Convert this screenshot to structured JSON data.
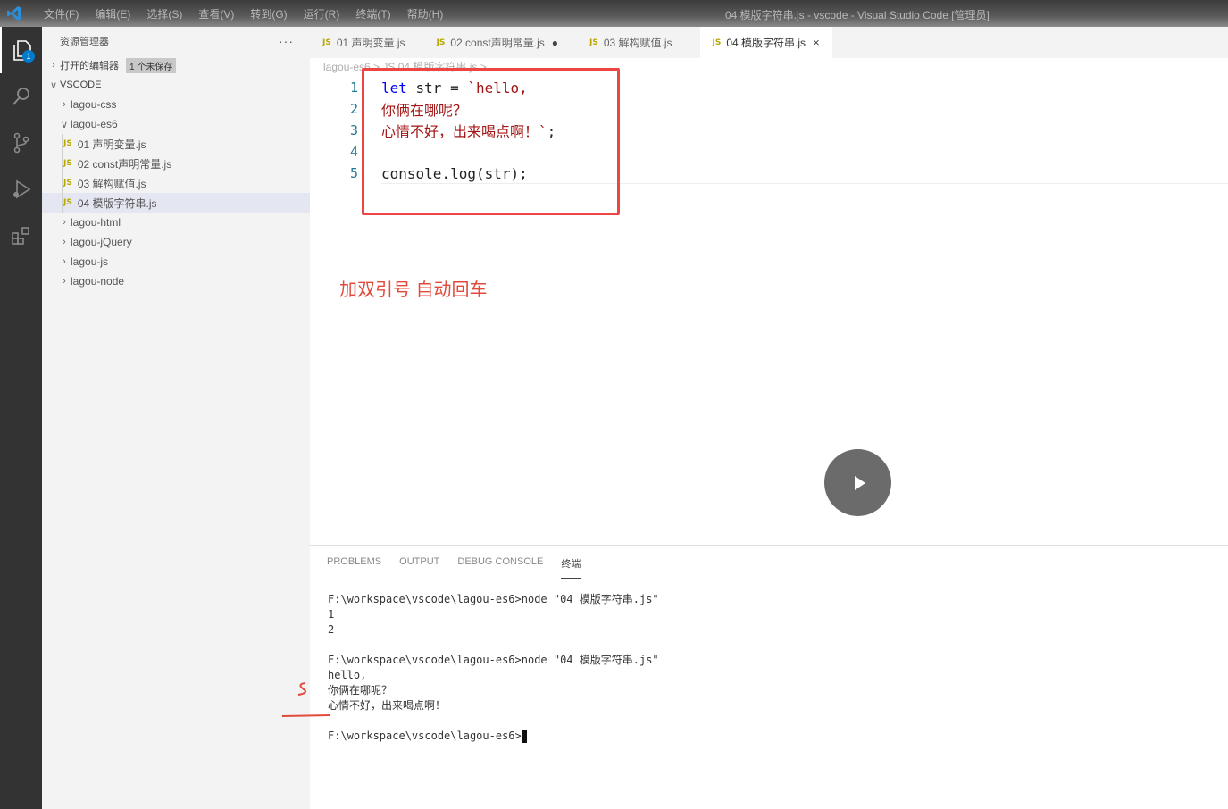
{
  "titlebar": {
    "menu": [
      "文件(F)",
      "编辑(E)",
      "选择(S)",
      "查看(V)",
      "转到(G)",
      "运行(R)",
      "终端(T)",
      "帮助(H)"
    ],
    "window_title": "04 模版字符串.js - vscode - Visual Studio Code [管理员]"
  },
  "activity": {
    "items": [
      "explorer-icon",
      "search-icon",
      "source-control-icon",
      "run-debug-icon",
      "extensions-icon"
    ],
    "explorer_badge": "1"
  },
  "sidebar": {
    "title": "资源管理器",
    "more": "···",
    "open_editors": {
      "label": "打开的编辑器",
      "tag": "1 个未保存"
    },
    "root": "VSCODE",
    "folders": {
      "lagou_css": "lagou-css",
      "lagou_es6": "lagou-es6",
      "lagou_html": "lagou-html",
      "lagou_jquery": "lagou-jQuery",
      "lagou_js": "lagou-js",
      "lagou_node": "lagou-node"
    },
    "files": [
      "01 声明变量.js",
      "02 const声明常量.js",
      "03 解构赋值.js",
      "04 模版字符串.js"
    ]
  },
  "tabs": [
    {
      "label": "01 声明变量.js"
    },
    {
      "label": "02 const声明常量.js",
      "dirty": "●"
    },
    {
      "label": "03 解构赋值.js"
    },
    {
      "label": "04 模版字符串.js",
      "close": "×"
    }
  ],
  "breadcrumb": "lagou-es6 > JS 04 模版字符串.js > ...",
  "editor": {
    "line_numbers": [
      "1",
      "2",
      "3",
      "4",
      "5"
    ],
    "line1_kw": "let",
    "line1_plain": " str = ",
    "line1_str": "`hello,",
    "line2_str": "你俩在哪呢？",
    "line3_str": "心情不好，出来喝点啊！`",
    "line3_plain": ";",
    "line5_plain": "console.log(str);",
    "annotation": "加双引号 自动回车"
  },
  "panel": {
    "tabs": [
      "PROBLEMS",
      "OUTPUT",
      "DEBUG CONSOLE",
      "终端"
    ],
    "active_tab": "终端",
    "terminal": [
      "F:\\workspace\\vscode\\lagou-es6>node \"04 模版字符串.js\"",
      "1",
      "2",
      "",
      "F:\\workspace\\vscode\\lagou-es6>node \"04 模版字符串.js\"",
      "hello,",
      "你俩在哪呢？",
      "心情不好，出来喝点啊！",
      "",
      "F:\\workspace\\vscode\\lagou-es6>"
    ]
  },
  "colors": {
    "accent": "#007acc",
    "annotation": "#e24a3b",
    "keyword": "#0000ff",
    "string": "#a31515"
  }
}
